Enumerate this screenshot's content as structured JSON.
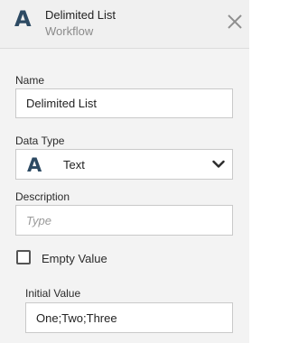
{
  "header": {
    "type_icon": "text-type-icon",
    "type_glyph": "A",
    "title": "Delimited List",
    "subtitle": "Workflow",
    "close_icon": "close-icon"
  },
  "form": {
    "name": {
      "label": "Name",
      "value": "Delimited List"
    },
    "data_type": {
      "label": "Data Type",
      "icon_glyph": "A",
      "icon": "text-type-icon",
      "value": "Text",
      "dropdown_icon": "chevron-down-icon"
    },
    "description": {
      "label": "Description",
      "placeholder": "Type",
      "value": ""
    },
    "empty_value": {
      "label": "Empty Value",
      "checked": false
    },
    "initial_value": {
      "label": "Initial Value",
      "value": "One;Two;Three"
    }
  },
  "colors": {
    "accent": "#2d4a63",
    "header_bg": "#f0f0f0",
    "panel_bg": "#f3f3f3",
    "border": "#c9c9c9"
  }
}
